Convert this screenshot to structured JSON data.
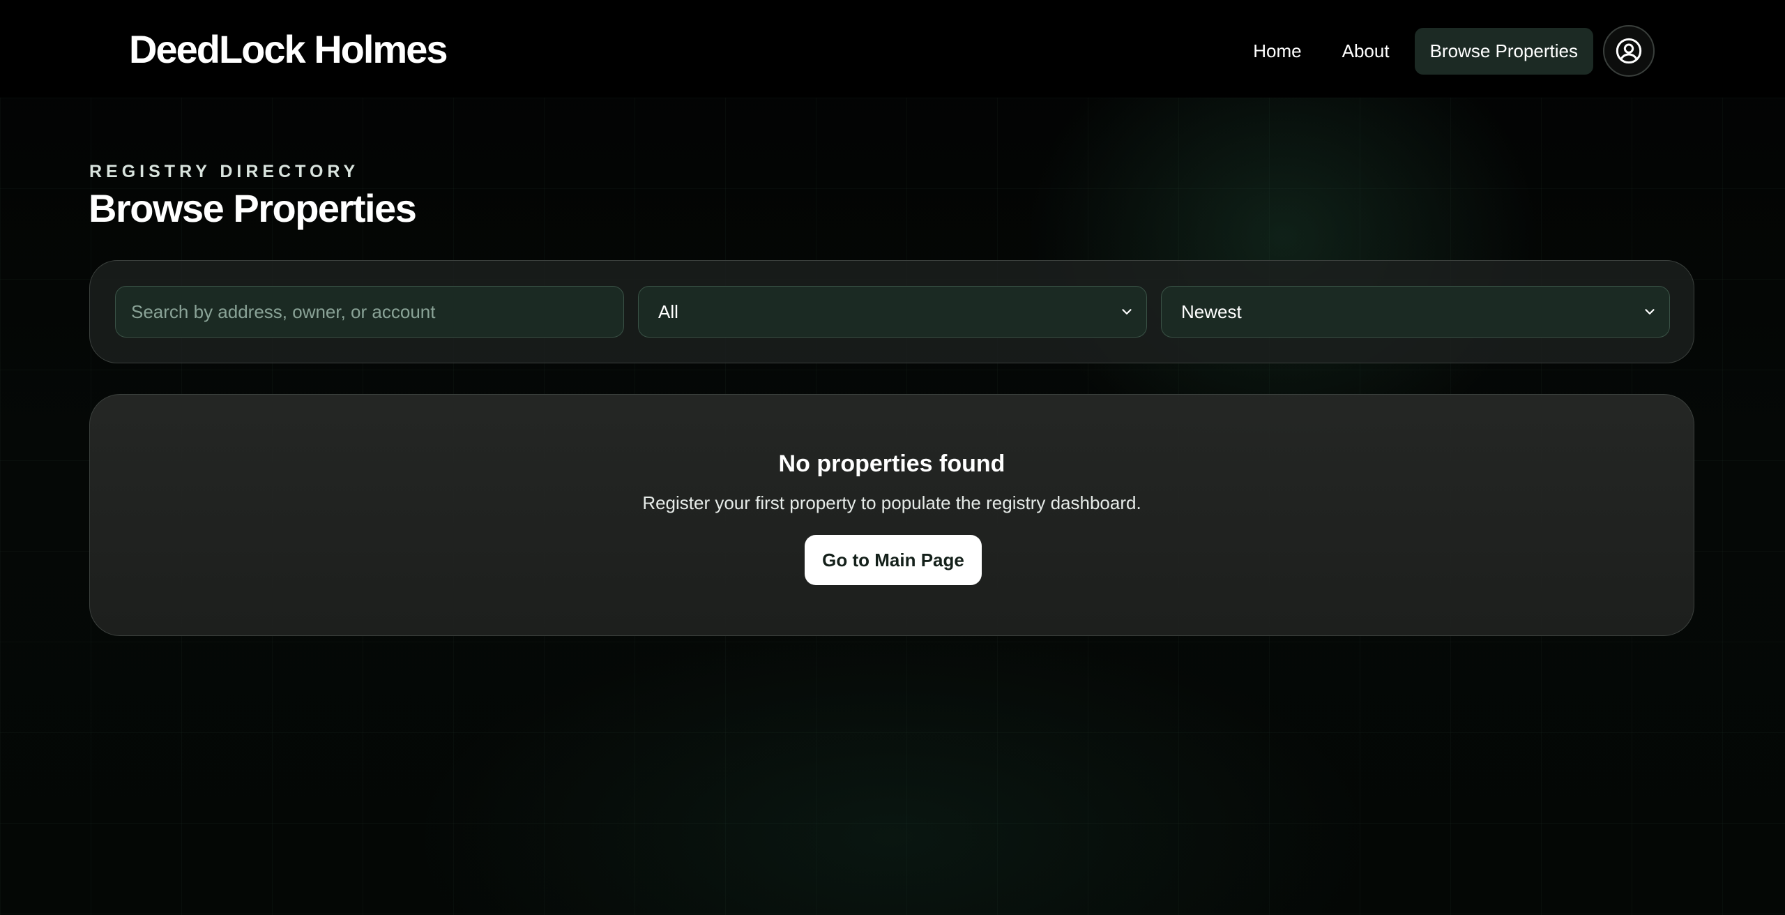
{
  "header": {
    "brand": "DeedLock Holmes",
    "nav": [
      {
        "label": "Home",
        "active": false
      },
      {
        "label": "About",
        "active": false
      },
      {
        "label": "Browse Properties",
        "active": true
      }
    ],
    "account_icon": "user-circle-icon"
  },
  "main": {
    "eyebrow": "REGISTRY DIRECTORY",
    "title": "Browse Properties"
  },
  "filters": {
    "search_placeholder": "Search by address, owner, or account",
    "search_value": "",
    "type_selected": "All",
    "sort_selected": "Newest"
  },
  "empty_state": {
    "title": "No properties found",
    "text": "Register your first property to populate the registry dashboard.",
    "button_label": "Go to Main Page"
  },
  "colors": {
    "accent_dark": "#1c2a24",
    "field_bg": "#1b2a23",
    "background": "#000000"
  }
}
